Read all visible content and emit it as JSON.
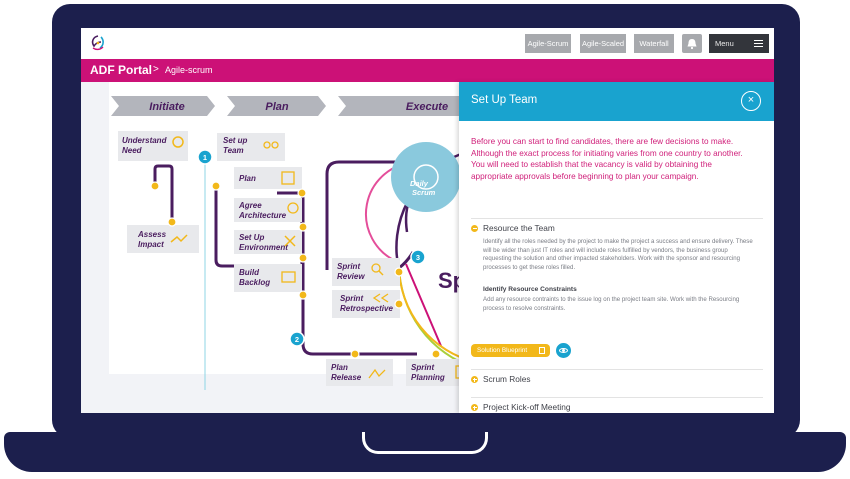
{
  "nav": {
    "buttons": [
      "Agile-Scrum",
      "Agile-Scaled",
      "Waterfall"
    ],
    "menu_label": "Menu"
  },
  "header": {
    "app_title": "ADF Portal",
    "separator": ">",
    "breadcrumb": "Agile-scrum"
  },
  "diagram": {
    "phases": [
      "Initiate",
      "Plan",
      "Execute"
    ],
    "steps": {
      "understand_need": [
        "Understand",
        "Need"
      ],
      "assess_impact": [
        "Assess",
        "Impact"
      ],
      "set_up_team": [
        "Set up",
        "Team"
      ],
      "plan": "Plan",
      "agree_architecture": [
        "Agree",
        "Architecture"
      ],
      "set_up_environment": [
        "Set Up",
        "Environment"
      ],
      "build_backlog": [
        "Build",
        "Backlog"
      ],
      "sprint_review": [
        "Sprint",
        "Review"
      ],
      "sprint_retrospective": [
        "Sprint",
        "Retrospective"
      ],
      "plan_release": [
        "Plan",
        "Release"
      ],
      "sprint_planning": [
        "Sprint",
        "Planning"
      ],
      "daily_scrum": [
        "Daily",
        "Scrum"
      ],
      "sprint_partial": "Sp"
    },
    "markers": [
      "1",
      "2",
      "3"
    ]
  },
  "panel": {
    "title": "Set Up Team",
    "close_icon": "×",
    "intro": "Before you can start to find candidates, there are few decisions to make. Although the exact process for initiating varies from one country to another. You will need to establish that the vacancy is valid by obtaining the appropriate approvals before beginning to plan your campaign.",
    "sections": [
      {
        "label": "Resource the Team",
        "expanded": true,
        "body": "Identify all the roles needed by the project to make the project a success and ensure delivery. These will be wider than just IT roles and will include roles fulfilled by vendors, the business group requesting the solution and other impacted stakeholders. Work with the sponsor and resourcing processes to get these roles filled.",
        "sub_heading": "Identify Resource Constraints",
        "sub_body": "Add any resource contraints to the issue log on the project team site. Work with the Resourcing process to resolve constraints.",
        "button_label": "Solution Blueprint"
      },
      {
        "label": "Scrum Roles",
        "expanded": false
      },
      {
        "label": "Project Kick-off Meeting",
        "expanded": false
      }
    ]
  },
  "colors": {
    "brand": "#cc1177",
    "accent": "#19a3cf",
    "frame": "#1c1f4d",
    "yellow": "#f2b81a",
    "purple": "#4a1d5f"
  },
  "icons": [
    "logo-icon",
    "bell-icon",
    "hamburger-icon",
    "close-icon",
    "document-icon",
    "eye-icon"
  ]
}
